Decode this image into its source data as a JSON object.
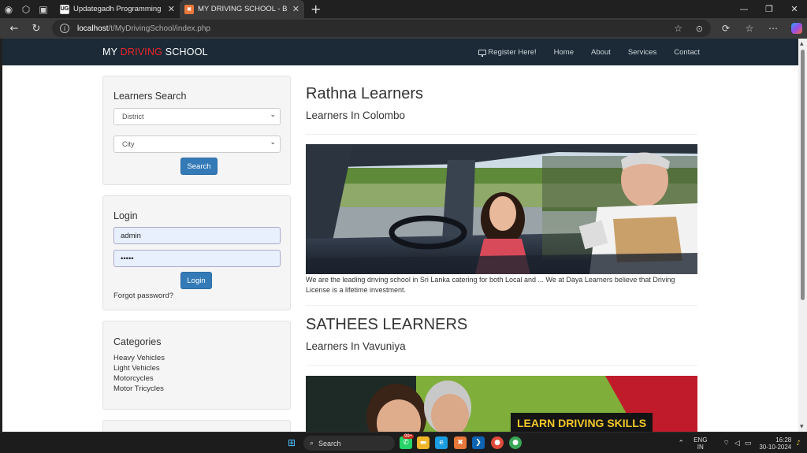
{
  "browser": {
    "tabs": [
      {
        "title": "Updategadh Programming - Upd",
        "favicon": "UG"
      },
      {
        "title": "MY DRIVING SCHOOL - Book You",
        "favicon": "XAMPP"
      }
    ],
    "url_host": "localhost",
    "url_path": "/t/MyDrivingSchool/index.php"
  },
  "navbar": {
    "brand_part1": "MY ",
    "brand_part2": "DRIVING",
    "brand_part3": " SCHOOL",
    "brand_accent_color": "#e8262b",
    "links": [
      "Register Here!",
      "Home",
      "About",
      "Services",
      "Contact"
    ]
  },
  "search_panel": {
    "title": "Learners Search",
    "district_placeholder": "District",
    "city_placeholder": "City",
    "search_label": "Search"
  },
  "login_panel": {
    "title": "Login",
    "username_value": "admin",
    "password_value": "•••••",
    "login_label": "Login",
    "forgot_label": "Forgot password?"
  },
  "categories_panel": {
    "title": "Categories",
    "items": [
      "Heavy Vehicles",
      "Light Vehicles",
      "Motorcycles",
      "Motor Tricycles"
    ]
  },
  "listings": [
    {
      "name": "Rathna Learners",
      "location": "Learners In Colombo",
      "description": "We are the leading driving school in Sri Lanka catering for both Local and ... We at Daya Learners believe that Driving License is a lifetime investment."
    },
    {
      "name": "SATHEES LEARNERS",
      "location": "Learners In Vavuniya",
      "banner_text": "LEARN DRIVING SKILLS"
    }
  ],
  "taskbar": {
    "search_label": "Search",
    "lang_line1": "ENG",
    "lang_line2": "IN",
    "time": "16:28",
    "date": "30-10-2024",
    "badge": "99+"
  },
  "colors": {
    "navbar_bg": "#1b2a36",
    "primary_button": "#337ab7"
  }
}
